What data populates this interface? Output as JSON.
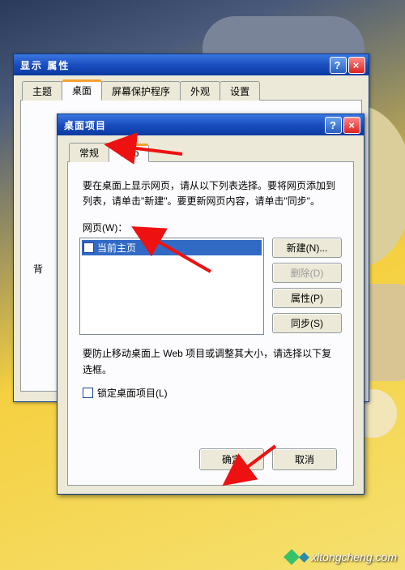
{
  "outer_window": {
    "title": "显示 属性",
    "tabs": [
      "主题",
      "桌面",
      "屏幕保护程序",
      "外观",
      "设置"
    ],
    "active_tab_index": 1,
    "panel_hint": "背"
  },
  "inner_window": {
    "title": "桌面项目",
    "tabs": [
      "常规",
      "Web"
    ],
    "active_tab_index": 1,
    "instructions": "要在桌面上显示网页，请从以下列表选择。要将网页添加到列表，请单击\"新建\"。要更新网页内容，请单击\"同步\"。",
    "list_label": "网页(W)：",
    "list_items": [
      {
        "label": "当前主页",
        "checked": false,
        "selected": true
      }
    ],
    "side_buttons": {
      "new": "新建(N)...",
      "delete": "删除(D)",
      "properties": "属性(P)",
      "sync": "同步(S)"
    },
    "prevent_text": "要防止移动桌面上 Web 项目或调整其大小，请选择以下复选框。",
    "lock_label": "锁定桌面项目(L)",
    "lock_checked": false,
    "ok": "确定",
    "cancel": "取消"
  },
  "watermark": "xitongcheng.com"
}
